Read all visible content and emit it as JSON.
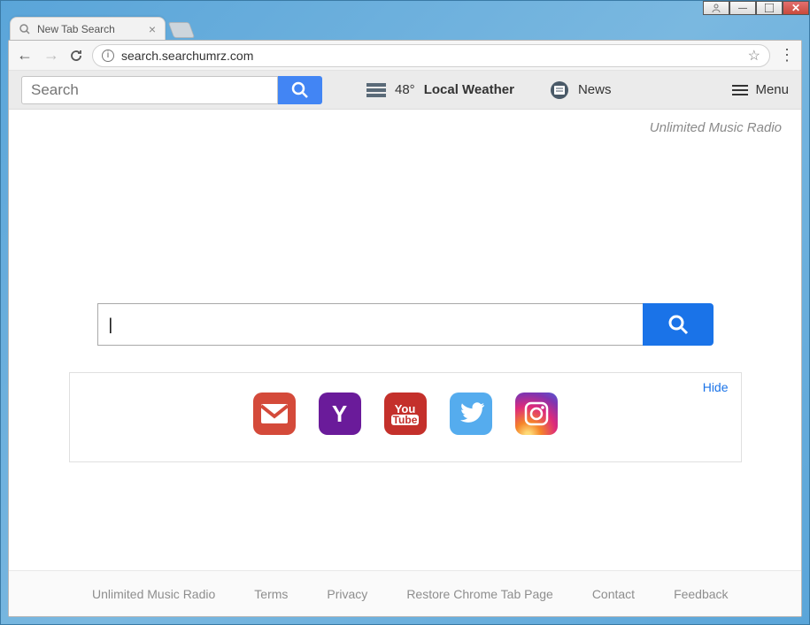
{
  "window": {
    "tab_title": "New Tab Search",
    "url": "search.searchumrz.com"
  },
  "toolbar": {
    "search_placeholder": "Search",
    "weather_temp": "48°",
    "weather_label": "Local Weather",
    "news_label": "News",
    "menu_label": "Menu"
  },
  "brand": "Unlimited Music Radio",
  "big_search_value": "|",
  "tiles": {
    "hide_label": "Hide",
    "items": [
      "Gmail",
      "Yahoo",
      "YouTube",
      "Twitter",
      "Instagram"
    ]
  },
  "footer": {
    "items": [
      "Unlimited Music Radio",
      "Terms",
      "Privacy",
      "Restore Chrome Tab Page",
      "Contact",
      "Feedback"
    ]
  }
}
